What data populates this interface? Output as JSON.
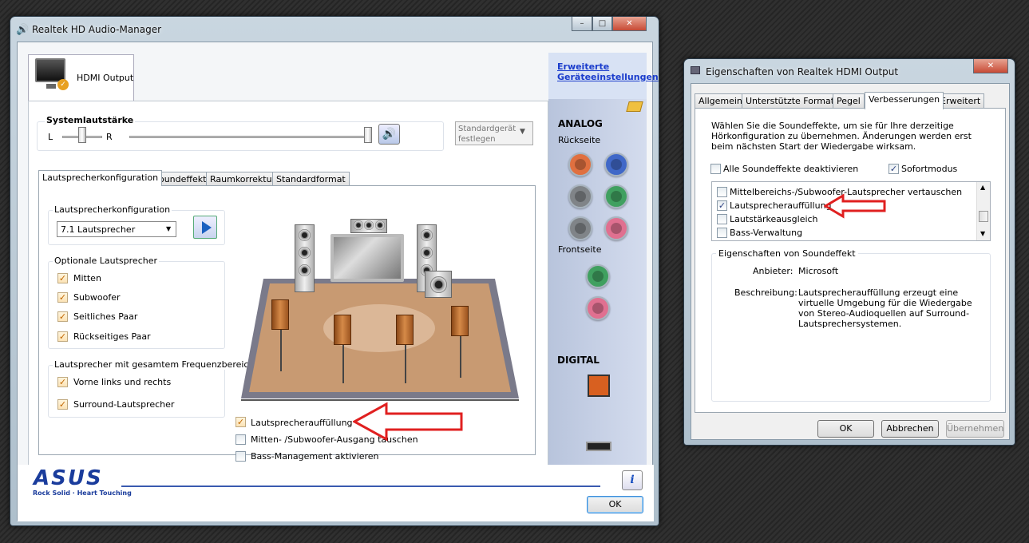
{
  "main": {
    "title": "Realtek HD Audio-Manager",
    "device_tab": "HDMI Output",
    "advanced_link": "Erweiterte Geräteeinstellungen",
    "volume": {
      "group": "Systemlautstärke",
      "left": "L",
      "right": "R",
      "level": 1.0,
      "balance": 0.5
    },
    "default_device": "Standardgerät festlegen",
    "tabs": [
      "Lautsprecherkonfiguration",
      "Soundeffekt",
      "Raumkorrektur",
      "Standardformat"
    ],
    "config": {
      "group": "Lautsprecherkonfiguration",
      "selected": "7.1 Lautsprecher"
    },
    "optional": {
      "group": "Optionale Lautsprecher",
      "items": [
        "Mitten",
        "Subwoofer",
        "Seitliches Paar",
        "Rückseitiges Paar"
      ]
    },
    "fullrange": {
      "group": "Lautsprecher mit gesamtem Frequenzbereich",
      "items": [
        "Vorne links und rechts",
        "Surround-Lautsprecher"
      ]
    },
    "options": [
      "Lautsprecherauffüllung",
      "Mitten- /Subwoofer-Ausgang tauschen",
      "Bass-Management aktivieren"
    ],
    "analog": "ANALOG",
    "rear": "Rückseite",
    "front": "Frontseite",
    "digital": "DIGITAL",
    "brand": "ASUS",
    "slogan": "Rock Solid · Heart Touching",
    "ok": "OK",
    "info": "i",
    "colors": {
      "title_grad": "#c9d6e0",
      "panel": "#c8d4ea",
      "link": "#1a3ccc",
      "floor": "#c89a72",
      "arrow": "#e02020"
    }
  },
  "props": {
    "title": "Eigenschaften von Realtek HDMI Output",
    "tabs": [
      "Allgemein",
      "Unterstützte Formate",
      "Pegel",
      "Verbesserungen",
      "Erweitert"
    ],
    "intro": "Wählen Sie die Soundeffekte, um sie für Ihre derzeitige Hörkonfiguration zu übernehmen. Änderungen werden erst beim nächsten Start der Wiedergabe wirksam.",
    "disable_all": "Alle Soundeffekte deaktivieren",
    "immediate": "Sofortmodus",
    "effects": [
      {
        "label": "Mittelbereichs-/Subwoofer-Lautsprecher vertauschen",
        "checked": false
      },
      {
        "label": "Lautsprecherauffüllung",
        "checked": true
      },
      {
        "label": "Lautstärkeausgleich",
        "checked": false
      },
      {
        "label": "Bass-Verwaltung",
        "checked": false
      }
    ],
    "group": "Eigenschaften von Soundeffekt",
    "provider_label": "Anbieter:",
    "provider": "Microsoft",
    "desc_label": "Beschreibung:",
    "desc": "Lautsprecherauffüllung erzeugt eine virtuelle Umgebung für die Wiedergabe von Stereo-Audioquellen auf Surround-Lautsprechersystemen.",
    "ok": "OK",
    "cancel": "Abbrechen",
    "apply": "Übernehmen"
  }
}
